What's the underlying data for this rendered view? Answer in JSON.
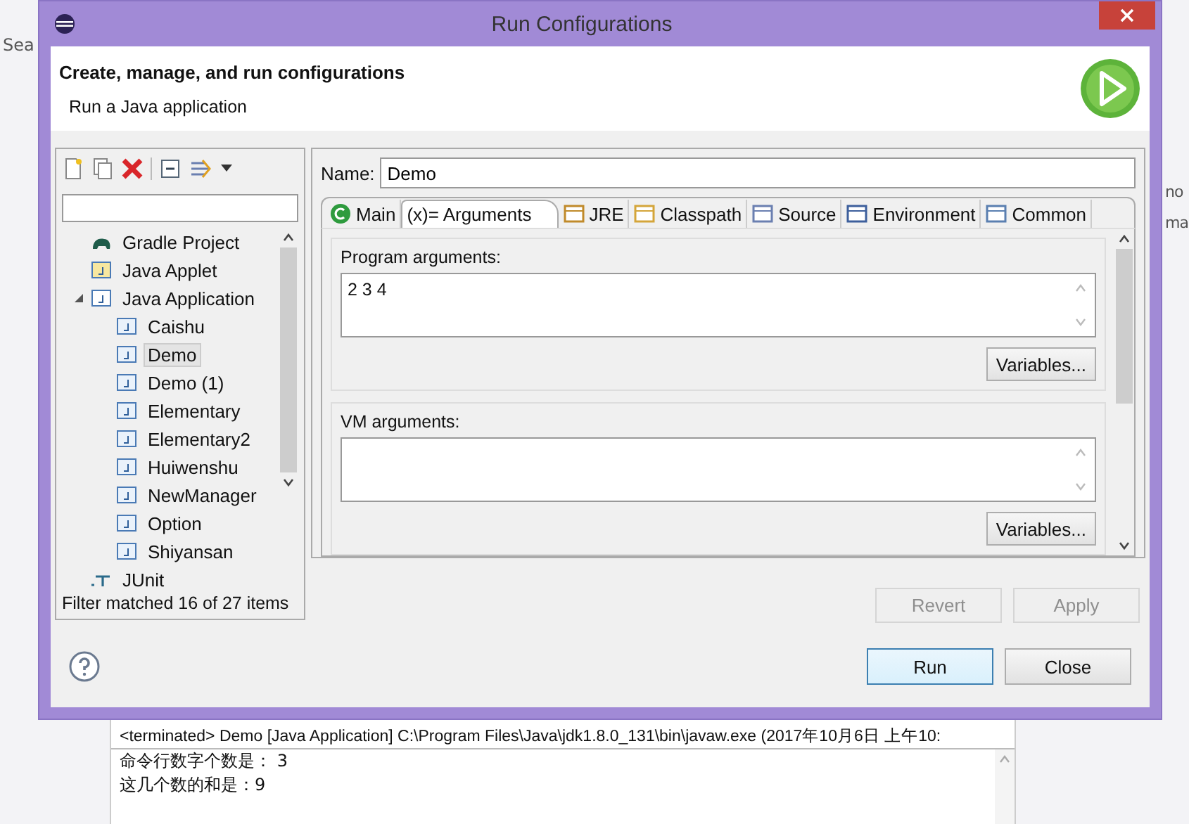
{
  "background": {
    "search_fragment": "Sea",
    "right_fragments": [
      "no",
      "ma"
    ]
  },
  "window": {
    "title": "Run Configurations"
  },
  "header": {
    "title": "Create, manage, and run configurations",
    "subtitle": "Run a Java application"
  },
  "tree": [
    {
      "label": "Gradle Project",
      "kind": "gradle",
      "selected": false
    },
    {
      "label": "Java Applet",
      "kind": "applet",
      "selected": false
    },
    {
      "label": "Java Application",
      "kind": "app",
      "selected": false,
      "expanded": true,
      "children": [
        {
          "label": "Caishu",
          "selected": false
        },
        {
          "label": "Demo",
          "selected": true
        },
        {
          "label": "Demo (1)",
          "selected": false
        },
        {
          "label": "Elementary",
          "selected": false
        },
        {
          "label": "Elementary2",
          "selected": false
        },
        {
          "label": "Huiwenshu",
          "selected": false
        },
        {
          "label": "NewManager",
          "selected": false
        },
        {
          "label": "Option",
          "selected": false
        },
        {
          "label": "Shiyansan",
          "selected": false
        }
      ]
    },
    {
      "label": "JUnit",
      "kind": "junit",
      "selected": false
    }
  ],
  "filter_status": "Filter matched 16 of 27 items",
  "name": {
    "label": "Name:",
    "value": "Demo"
  },
  "tabs": [
    {
      "label": "Main",
      "kind": "main",
      "selected": false
    },
    {
      "label": "(x)= Arguments",
      "kind": "arguments",
      "selected": true
    },
    {
      "label": "JRE",
      "kind": "jre",
      "selected": false
    },
    {
      "label": "Classpath",
      "kind": "classpath",
      "selected": false
    },
    {
      "label": "Source",
      "kind": "source",
      "selected": false
    },
    {
      "label": "Environment",
      "kind": "environment",
      "selected": false
    },
    {
      "label": "Common",
      "kind": "common",
      "selected": false
    }
  ],
  "program_arguments": {
    "label": "Program arguments:",
    "value": "2 3 4",
    "button": "Variables..."
  },
  "vm_arguments": {
    "label": "VM arguments:",
    "button": "Variables..."
  },
  "actions": [
    {
      "label": "Revert",
      "disabled": true
    },
    {
      "label": "Apply",
      "disabled": true
    }
  ],
  "buttons": [
    {
      "label": "Run",
      "default": true
    },
    {
      "label": "Close",
      "default": false
    }
  ],
  "console": {
    "header": "<terminated> Demo [Java Application] C:\\Program Files\\Java\\jdk1.8.0_131\\bin\\javaw.exe (2017年10月6日 上午10:",
    "lines": [
      "命令行数字个数是： 3",
      "这几个数的和是：9"
    ]
  }
}
